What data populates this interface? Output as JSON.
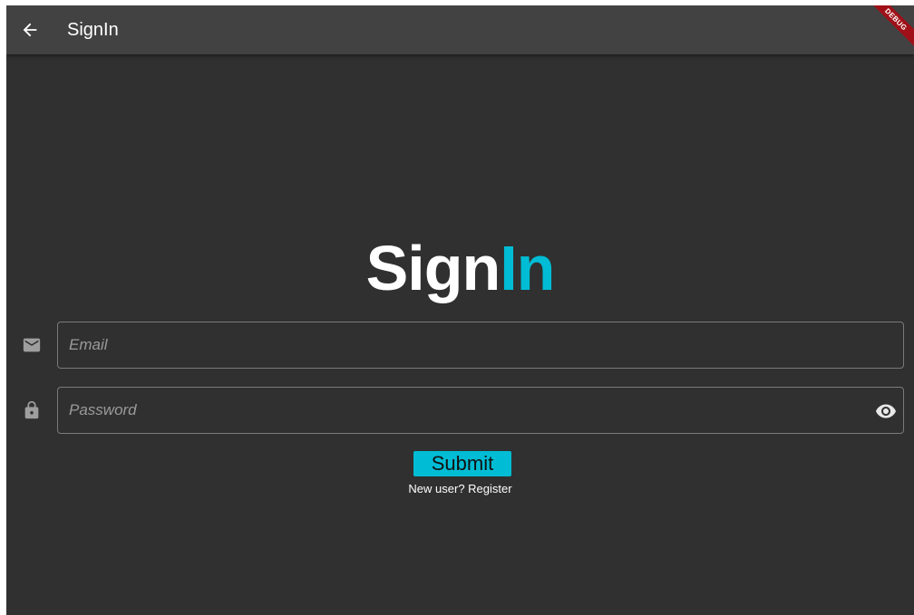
{
  "app_bar": {
    "title": "SignIn",
    "back_icon": "arrow-back-icon",
    "debug_label": "DEBUG"
  },
  "hero": {
    "part1": "Sign",
    "part2": "In"
  },
  "email_field": {
    "icon": "mail-icon",
    "placeholder": "Email",
    "value": ""
  },
  "password_field": {
    "icon": "lock-icon",
    "placeholder": "Password",
    "value": "",
    "toggle_icon": "eye-icon"
  },
  "submit_label": "Submit",
  "register_text": "New user? Register",
  "colors": {
    "background": "#303030",
    "appbar": "#424242",
    "accent": "#00bcd4",
    "debug_banner": "#a01018"
  }
}
